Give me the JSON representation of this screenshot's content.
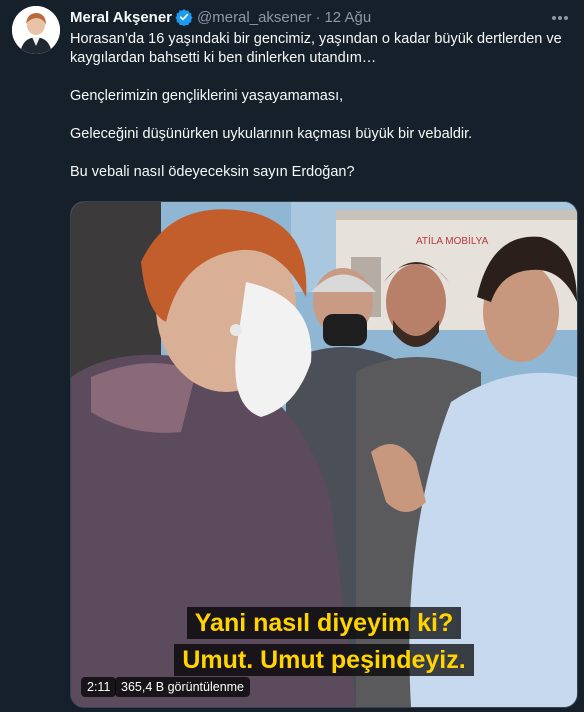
{
  "tweet": {
    "author_name": "Meral Akşener",
    "handle": "@meral_aksener",
    "separator": "·",
    "date": "12 Ağu",
    "text": [
      "Horasan’da 16 yaşındaki bir gencimiz, yaşından o kadar büyük dertlerden ve kaygılardan bahsetti ki ben dinlerken utandım…",
      "Gençlerimizin gençliklerini yaşayamaması,",
      "Geleceğini düşünürken uykularının kaçması büyük bir vebaldir.",
      "Bu vebali nasıl ödeyeceksin sayın Erdoğan?"
    ]
  },
  "video": {
    "sign_text": "ATİLA MOBİLYA",
    "subtitle_line1": "Yani nasıl diyeyim ki?",
    "subtitle_line2": "Umut. Umut peşindeyiz.",
    "duration": "2:11",
    "views": "365,4 B görüntülenme"
  },
  "colors": {
    "background": "#15202b",
    "text": "#f7f9f9",
    "muted": "#8b98a5",
    "verified": "#1d9bf0",
    "subtitle": "#ffd400"
  },
  "icons": {
    "verified": "verified-badge-icon",
    "more": "more-options-icon"
  }
}
